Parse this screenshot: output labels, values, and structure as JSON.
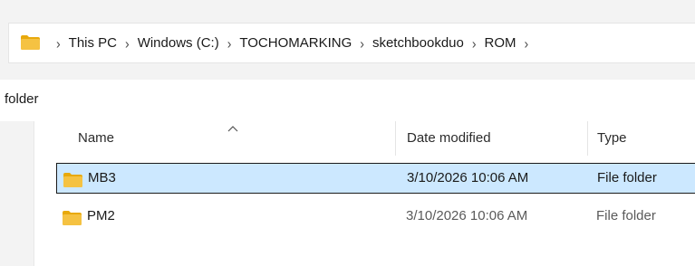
{
  "address_bar": {
    "breadcrumbs": [
      "This PC",
      "Windows (C:)",
      "TOCHOMARKING",
      "sketchbookduo",
      "ROM"
    ]
  },
  "side_label": "folder",
  "columns": {
    "name": "Name",
    "date_modified": "Date modified",
    "type": "Type"
  },
  "files": [
    {
      "name": "MB3",
      "date_modified": "3/10/2026 10:06 AM",
      "type": "File folder",
      "selected": true
    },
    {
      "name": "PM2",
      "date_modified": "3/10/2026 10:06 AM",
      "type": "File folder",
      "selected": false
    }
  ],
  "colors": {
    "folder_yellow": "#f5c242",
    "selection": "#cce8ff"
  },
  "icons": {
    "address_icon": "folder-icon",
    "sort": "sort-ascending-icon"
  }
}
